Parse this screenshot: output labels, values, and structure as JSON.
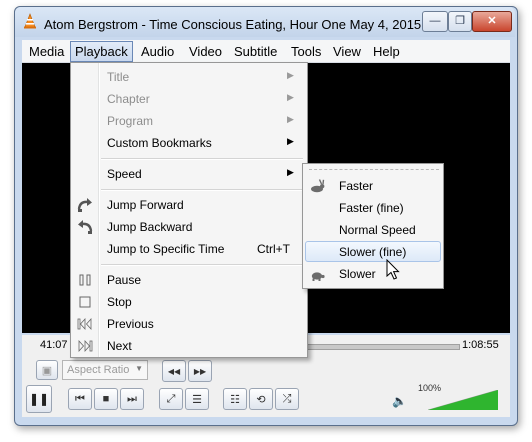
{
  "window": {
    "title": "Atom Bergstrom - Time Conscious Eating, Hour One May 4, 2015 ...",
    "buttons": {
      "minimize": "—",
      "maximize": "❐",
      "close": "✕"
    }
  },
  "menubar": [
    "Media",
    "Playback",
    "Audio",
    "Video",
    "Subtitle",
    "Tools",
    "View",
    "Help"
  ],
  "playback_menu": {
    "items": [
      {
        "label": "Title",
        "enabled": false,
        "submenu": true
      },
      {
        "label": "Chapter",
        "enabled": false,
        "submenu": true
      },
      {
        "label": "Program",
        "enabled": false,
        "submenu": true
      },
      {
        "label": "Custom Bookmarks",
        "enabled": true,
        "submenu": true
      },
      {
        "label": "Speed",
        "enabled": true,
        "submenu": true
      },
      {
        "label": "Jump Forward",
        "enabled": true,
        "icon": "jump-forward-icon"
      },
      {
        "label": "Jump Backward",
        "enabled": true,
        "icon": "jump-backward-icon"
      },
      {
        "label": "Jump to Specific Time",
        "enabled": true,
        "shortcut": "Ctrl+T"
      },
      {
        "label": "Pause",
        "enabled": true,
        "icon": "pause-icon"
      },
      {
        "label": "Stop",
        "enabled": true,
        "icon": "stop-icon"
      },
      {
        "label": "Previous",
        "enabled": true,
        "icon": "previous-icon"
      },
      {
        "label": "Next",
        "enabled": true,
        "icon": "next-icon"
      }
    ],
    "arrow": "▶"
  },
  "speed_submenu": {
    "items": [
      {
        "label": "Faster",
        "icon": "rabbit-icon"
      },
      {
        "label": "Faster (fine)"
      },
      {
        "label": "Normal Speed"
      },
      {
        "label": "Slower (fine)",
        "highlighted": true
      },
      {
        "label": "Slower",
        "icon": "turtle-icon"
      }
    ]
  },
  "player": {
    "elapsed": "41:07",
    "duration": "1:08:55",
    "aspect_ratio_placeholder": "Aspect Ratio",
    "volume_text": "100%",
    "volume_level": 1.0,
    "controls": {
      "pause": "❚❚",
      "prev": "⏮",
      "stop": "■",
      "next": "⏭",
      "fullscreen": "⤢",
      "ext_settings": "☰",
      "playlist": "☷",
      "loop": "⟲",
      "shuffle": "⤮",
      "slower": "◀◀",
      "faster": "▶▶",
      "snapshot": "▣",
      "speaker": "🔈"
    }
  },
  "colors": {
    "accent": "#6a88b6",
    "highlight": "#dde9f8",
    "volume_green": "#2fb52f"
  }
}
